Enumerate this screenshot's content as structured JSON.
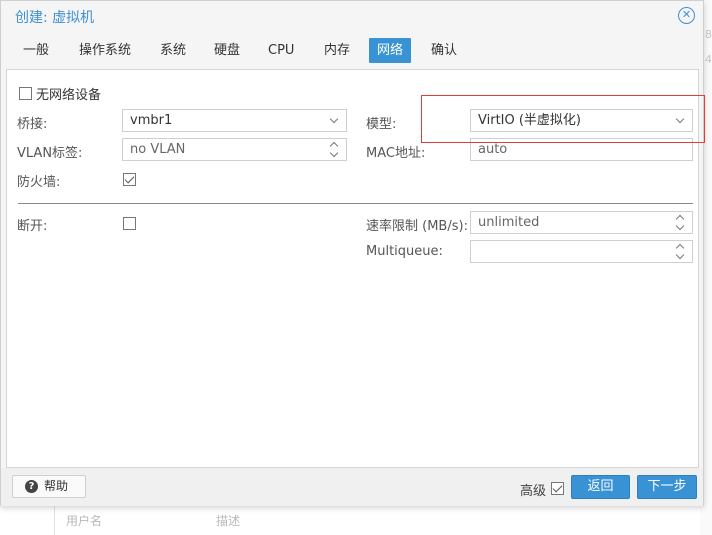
{
  "window": {
    "title": "创建: 虚拟机"
  },
  "tabs": [
    {
      "label": "一般"
    },
    {
      "label": "操作系统"
    },
    {
      "label": "系统"
    },
    {
      "label": "硬盘"
    },
    {
      "label": "CPU"
    },
    {
      "label": "内存"
    },
    {
      "label": "网络",
      "active": true
    },
    {
      "label": "确认"
    }
  ],
  "form": {
    "no_network_label": "无网络设备",
    "bridge_label": "桥接:",
    "bridge_value": "vmbr1",
    "vlan_label": "VLAN标签:",
    "vlan_value": "no VLAN",
    "firewall_label": "防火墙:",
    "model_label": "模型:",
    "model_value": "VirtIO (半虚拟化)",
    "mac_label": "MAC地址:",
    "mac_value": "auto",
    "disconnect_label": "断开:",
    "rate_label": "速率限制 (MB/s):",
    "rate_value": "unlimited",
    "multiqueue_label": "Multiqueue:",
    "multiqueue_value": ""
  },
  "footer": {
    "help_label": "帮助",
    "advanced_label": "高级",
    "back_label": "返回",
    "next_label": "下一步"
  },
  "background": {
    "col1": "用户名",
    "col2": "描述",
    "edge_chars": [
      "8",
      "4"
    ]
  },
  "colors": {
    "accent": "#3892d4",
    "highlight": "#e23b3b"
  }
}
